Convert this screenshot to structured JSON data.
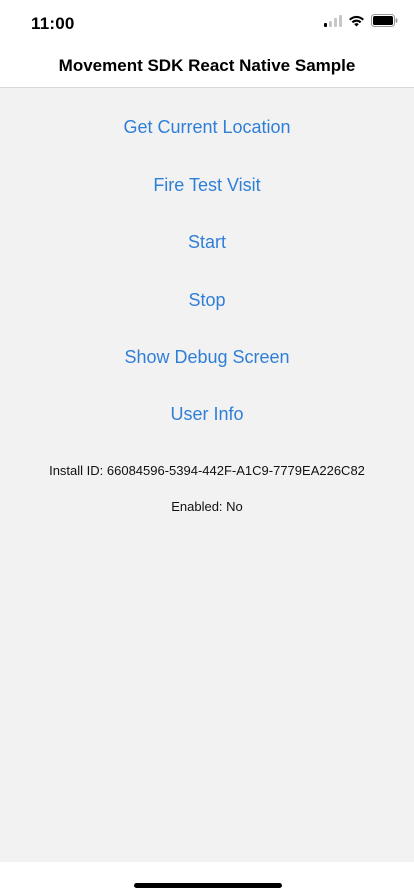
{
  "status_bar": {
    "time": "11:00",
    "icons": [
      "signal-icon",
      "wifi-icon",
      "battery-icon"
    ]
  },
  "nav": {
    "title": "Movement SDK React Native Sample"
  },
  "actions": [
    {
      "label": "Get Current Location"
    },
    {
      "label": "Fire Test Visit"
    },
    {
      "label": "Start"
    },
    {
      "label": "Stop"
    },
    {
      "label": "Show Debug Screen"
    },
    {
      "label": "User Info"
    }
  ],
  "info": {
    "install_id": "Install ID: 66084596-5394-442F-A1C9-7779EA226C82",
    "enabled": "Enabled: No"
  },
  "colors": {
    "link": "#2f7fd8",
    "background": "#f2f2f2"
  }
}
